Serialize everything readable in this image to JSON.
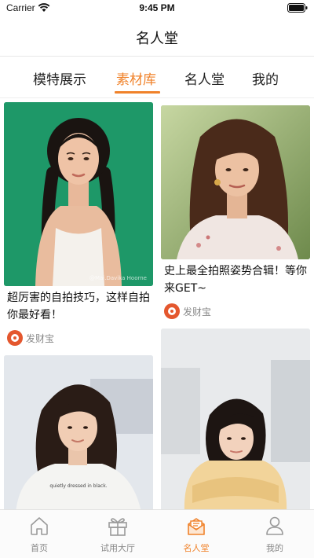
{
  "status_bar": {
    "carrier": "Carrier",
    "time": "9:45 PM",
    "icons": [
      "wifi-icon",
      "battery-icon"
    ]
  },
  "nav": {
    "title": "名人堂"
  },
  "tabs": [
    {
      "label": "模特展示",
      "active": false
    },
    {
      "label": "素材库",
      "active": true
    },
    {
      "label": "名人堂",
      "active": false
    },
    {
      "label": "我的",
      "active": false
    }
  ],
  "feed": {
    "cards": [
      {
        "title": "超厉害的自拍技巧，这样自拍你最好看！",
        "author": "发财宝",
        "image": "photo-woman-braids-green-background",
        "watermark": "@Mai.Davika Hoorne"
      },
      {
        "title": "史上最全拍照姿势合辑！等你来GET~",
        "author": "发财宝",
        "image": "photo-woman-long-hair-outdoor"
      },
      {
        "image": "photo-woman-white-tshirt",
        "shirt_text": "quietly dressed in black."
      },
      {
        "image": "photo-woman-yellow-sweater"
      }
    ]
  },
  "tabbar": {
    "items": [
      {
        "label": "首页",
        "icon": "home-icon",
        "active": false
      },
      {
        "label": "试用大厅",
        "icon": "gift-icon",
        "active": false
      },
      {
        "label": "名人堂",
        "icon": "envelope-icon",
        "active": true
      },
      {
        "label": "我的",
        "icon": "user-icon",
        "active": false
      }
    ]
  },
  "colors": {
    "accent": "#f0822a",
    "inactive": "#888888",
    "author_avatar": "#e4572e"
  }
}
